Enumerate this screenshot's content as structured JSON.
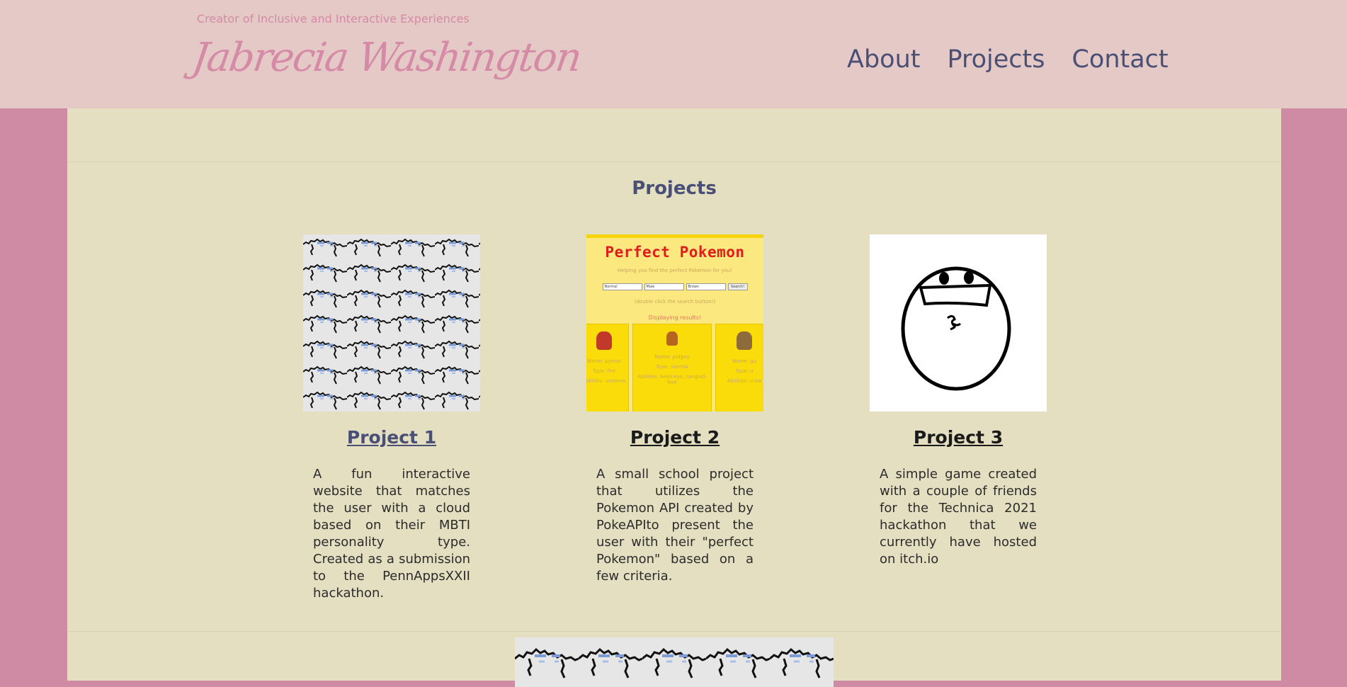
{
  "header": {
    "tagline": "Creator of Inclusive and Interactive Experiences",
    "name": "Jabrecia Washington",
    "nav": [
      {
        "label": "About"
      },
      {
        "label": "Projects"
      },
      {
        "label": "Contact"
      }
    ]
  },
  "projects_section": {
    "title": "Projects",
    "items": [
      {
        "title": "Project 1",
        "description": "A fun interactive website that matches the user with a cloud based on their MBTI personality type. Created as a submission to the PennAppsXXII hackathon.",
        "link_color": "#4a4f76"
      },
      {
        "title": "Project 2",
        "description": "A small school project that utilizes the Pokemon API created by PokeAPIto present the user with their \"perfect Pokemon\" based on a few criteria.",
        "link_color": "#1a1a1a",
        "thumbnail": {
          "title": "Perfect Pokemon",
          "subtitle": "Helping you find the perfect Pokemon for you!",
          "selects": [
            "Normal",
            "Male",
            "Brown"
          ],
          "button": "Search!",
          "note": "(double click the search button!)",
          "results": "Displaying results!",
          "cards": [
            {
              "name": "Name: pyroar",
              "type": "Type: fire",
              "abilities": "Abilities: unnerve"
            },
            {
              "name": "Name: pidgey",
              "type": "Type: normal",
              "abilities": "Abilities: keen-eye, tangled-feet"
            },
            {
              "name": "Name: gu",
              "type": "Type: n",
              "abilities": "Abilities: craw"
            }
          ]
        }
      },
      {
        "title": "Project 3",
        "description": "A simple game created with a couple of friends for the Technica 2021 hackathon that we currently have hosted on itch.io",
        "link_color": "#1a1a1a"
      }
    ]
  },
  "colors": {
    "page_bg": "#cf8ba4",
    "header_bg": "#e4c9c6",
    "content_bg": "#e5dfc1",
    "accent_pink": "#d58aa6",
    "nav_text": "#4a4f76"
  }
}
